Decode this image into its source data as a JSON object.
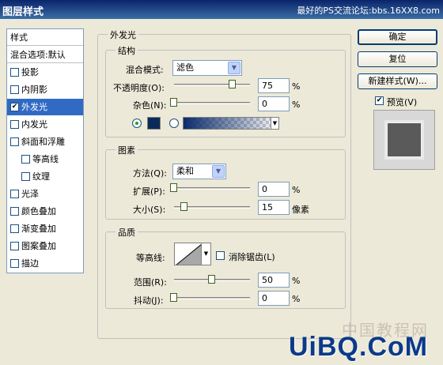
{
  "window": {
    "title": "图层样式",
    "forum_text": "最好的PS交流论坛:bbs.16XX8.com"
  },
  "sidebar": {
    "styles_label": "样式",
    "blend_label": "混合选项:默认",
    "items": [
      {
        "label": "投影",
        "checked": false
      },
      {
        "label": "内阴影",
        "checked": false
      },
      {
        "label": "外发光",
        "checked": true,
        "selected": true
      },
      {
        "label": "内发光",
        "checked": false
      },
      {
        "label": "斜面和浮雕",
        "checked": false
      },
      {
        "label": "等高线",
        "checked": false,
        "indent": true
      },
      {
        "label": "纹理",
        "checked": false,
        "indent": true
      },
      {
        "label": "光泽",
        "checked": false
      },
      {
        "label": "颜色叠加",
        "checked": false
      },
      {
        "label": "渐变叠加",
        "checked": false
      },
      {
        "label": "图案叠加",
        "checked": false
      },
      {
        "label": "描边",
        "checked": false
      }
    ]
  },
  "panel": {
    "title": "外发光",
    "structure": {
      "title": "结构",
      "blend_mode_label": "混合模式:",
      "blend_mode_value": "滤色",
      "opacity_label": "不透明度(O):",
      "opacity_value": "75",
      "noise_label": "杂色(N):",
      "noise_value": "0",
      "percent": "%"
    },
    "elements": {
      "title": "图素",
      "method_label": "方法(Q):",
      "method_value": "柔和",
      "spread_label": "扩展(P):",
      "spread_value": "0",
      "size_label": "大小(S):",
      "size_value": "15",
      "size_unit": "像素",
      "percent": "%"
    },
    "quality": {
      "title": "品质",
      "contour_label": "等高线:",
      "antialias_label": "消除锯齿(L)",
      "range_label": "范围(R):",
      "range_value": "50",
      "jitter_label": "抖动(J):",
      "jitter_value": "0",
      "percent": "%"
    },
    "glow_color": "#0a2a5a"
  },
  "buttons": {
    "ok": "确定",
    "reset": "复位",
    "new_style": "新建样式(W)...",
    "preview_label": "预览(V)",
    "preview_checked": true
  },
  "watermark": {
    "logo_text": "UiBQ.CoM",
    "cn_text": "中国教程网"
  }
}
